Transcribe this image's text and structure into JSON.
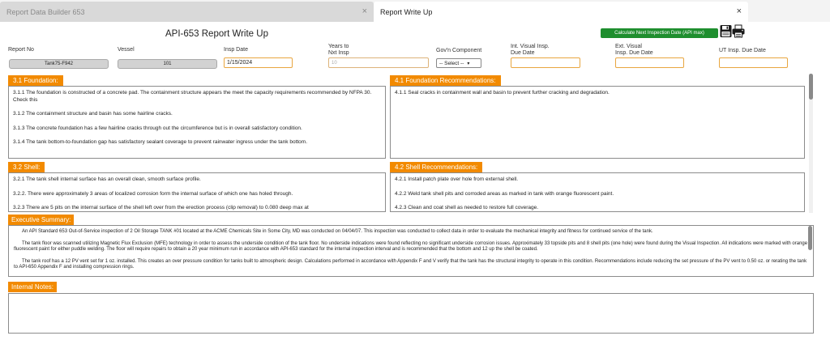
{
  "tabs": [
    {
      "label": "Report Data Builder 653"
    },
    {
      "label": "Report Write Up"
    }
  ],
  "tab_close_glyph": "×",
  "form": {
    "title": "API-653 Report Write Up",
    "calc_button": "Calculate Next Inspection Date (API max)",
    "report_no_label": "Report No",
    "report_no": "Tank75-F942",
    "vessel_label": "Vessel",
    "vessel": "101",
    "insp_date_label": "Insp Date",
    "insp_date": "1/15/2024",
    "years_label_1": "Years to",
    "years_label_2": "Nxt Insp",
    "years_value": "10",
    "gov_label": "Gov'n Component",
    "gov_selected": "-- Select --",
    "int_label_1": "Int. Visual Insp.",
    "int_label_2": "Due Date",
    "ext_label_1": "Ext. Visual",
    "ext_label_2": "Insp. Due Date",
    "ut_label": "UT Insp. Due Date"
  },
  "sections": {
    "foundation": {
      "title": "3.1 Foundation:",
      "lines": [
        "3.1.1  The foundation is constructed of a concrete pad. The containment structure appears the meet the capacity requirements recommended by NFPA 30.  Check this",
        "3.1.2   The containment structure and basin has some hairline cracks.",
        "3.1.3  The concrete foundation has a few hairline cracks through out the circumference but is in overall satisfactory condition.",
        "3.1.4  The tank bottom-to-foundation gap has satisfactory sealant coverage to prevent rainwater ingress under the tank bottom."
      ]
    },
    "foundation_rec": {
      "title": "4.1 Foundation Recommendations:",
      "lines": [
        "4.1.1  Seal cracks in containment wall and basin to prevent further cracking and degradation."
      ]
    },
    "shell": {
      "title": "3.2 Shell:",
      "lines": [
        "3.2.1  The tank shell internal surface has an overall clean, smooth surface profile.",
        "3.2.2.  There were approximately 3 areas of localized corrosion form the internal surface of which one has holed through.",
        "3.2.3  There are 5 pits on the internal surface of the shell left over from the erection process (clip removal) to 0.080 deep max at"
      ]
    },
    "shell_rec": {
      "title": "4.2 Shell Recommendations:",
      "lines": [
        "4.2.1  Install patch plate over hole from external shell.",
        "4.2.2    Weld tank shell pits and corroded areas as marked in tank with orange fluorescent paint.",
        "4.2.3  Clean and coat shell as needed to restore full coverage."
      ]
    },
    "summary": {
      "title": "Executive Summary:",
      "paragraphs": [
        "An API Standard 653 Out-of-Service inspection of 2 Oil Storage TANK #01 located at the ACME Chemicals Site in Some City, MD was conducted on 04/04/07. This inspection was conducted to collect data in order to evaluate the mechanical integrity and fitness for continued service of the tank.",
        "The tank floor was scanned utilizing Magnetic Flux Exclusion (MFE) technology in order to assess the underside condition of the tank floor.  No underside indications were found reflecting no significant underside corrosion issues. Approximately 33 topside pits and 8 shell pits (one hole) were found during the Visual Inspection.  All indications were marked with orange fluorescent paint for either puddle welding.  The floor will require repairs to obtain a 20 year minimum run in accordance with API-653 standard for the internal inspection interval and is recommended that the bottom and 12 up the shell be coated.",
        "The tank roof has a 12 PV vent set for 1 oz. installed. This creates an over pressure condition for tanks built to atmospheric design.  Calculations performed in accordance with Appendix F and V verify that the tank has the structural integrity to operate in this condition.  Recommendations include reducing the set pressure of the PV vent to 0.50 oz. or rerating the tank to API-650 Appendix F and installing compression rings."
      ]
    },
    "notes": {
      "title": "Internal Notes:"
    }
  },
  "colors": {
    "accent": "#f28a00",
    "green": "#1e8e2e",
    "input_border": "#e8a640"
  },
  "icons": [
    "save-icon",
    "print-icon",
    "close-icon",
    "dropdown-chevron-icon"
  ]
}
